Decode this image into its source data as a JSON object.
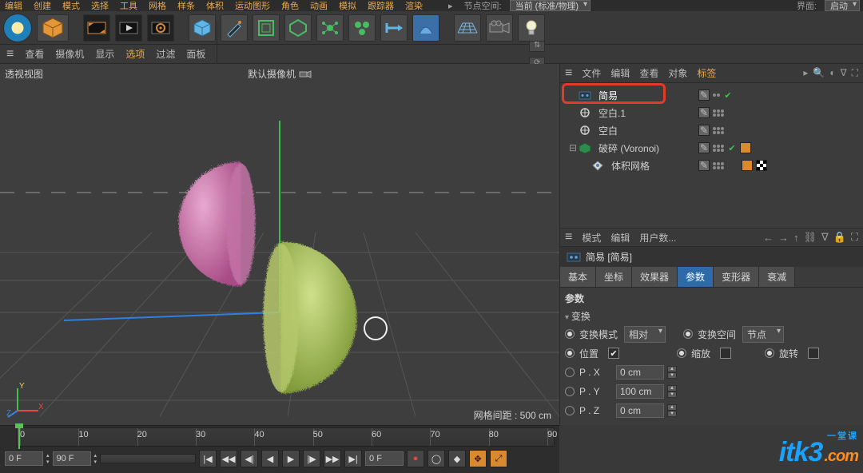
{
  "top_menu": {
    "items": [
      "编辑",
      "创建",
      "模式",
      "选择",
      "工具",
      "网格",
      "样条",
      "体积",
      "运动图形",
      "角色",
      "动画",
      "模拟",
      "跟踪器",
      "渲染"
    ],
    "node_space_label": "节点空间:",
    "node_space_value": "当前 (标准/物理)",
    "layout_label": "界面:",
    "layout_value": "启动"
  },
  "viewport_menu": {
    "items": [
      "查看",
      "摄像机",
      "显示",
      "选项",
      "过滤",
      "面板"
    ],
    "highlight_index": 3
  },
  "viewport": {
    "title": "透视视图",
    "camera": "默认摄像机",
    "status": "网格间距 : 500 cm"
  },
  "object_manager": {
    "menu": [
      "文件",
      "编辑",
      "查看",
      "对象",
      "标签"
    ],
    "highlight_index": 4,
    "rows": [
      {
        "name": "简易",
        "icon": "effector",
        "depth": 0,
        "sel": true,
        "tags": [
          "edit",
          "check-green"
        ]
      },
      {
        "name": "空白.1",
        "icon": "null",
        "depth": 0,
        "tags": [
          "edit",
          "dots"
        ]
      },
      {
        "name": "空白",
        "icon": "null",
        "depth": 0,
        "tags": [
          "edit",
          "dots"
        ]
      },
      {
        "name": "破碎 (Voronoi)",
        "icon": "voronoi",
        "depth": 0,
        "expand": "-",
        "tags": [
          "edit",
          "dots",
          "check-green",
          "orange"
        ]
      },
      {
        "name": "体积网格",
        "icon": "volmesh",
        "depth": 1,
        "tags": [
          "edit",
          "dots",
          "orange",
          "checker"
        ]
      }
    ]
  },
  "attribute_manager": {
    "menu": [
      "模式",
      "编辑",
      "用户数..."
    ],
    "title_icon": "effector",
    "title": "简易 [简易]",
    "tabs": [
      "基本",
      "坐标",
      "效果器",
      "参数",
      "变形器",
      "衰减"
    ],
    "active_tab": 3,
    "section": "参数",
    "subsection": "变换",
    "rows": {
      "transform_mode": {
        "label": "变换模式",
        "value": "相对"
      },
      "transform_space": {
        "label": "变换空间",
        "value": "节点"
      },
      "position": {
        "label": "位置",
        "checked": true
      },
      "scale": {
        "label": "缩放",
        "checked": false
      },
      "rotation": {
        "label": "旋转",
        "checked": false
      },
      "px": {
        "label": "P . X",
        "value": "0 cm"
      },
      "py": {
        "label": "P . Y",
        "value": "100 cm"
      },
      "pz": {
        "label": "P . Z",
        "value": "0 cm"
      }
    }
  },
  "timeline": {
    "ticks": [
      0,
      10,
      20,
      30,
      40,
      50,
      60,
      70,
      80,
      90
    ],
    "cursor": 0,
    "range_start": "0 F",
    "range_end": "90 F",
    "current": "0 F"
  },
  "watermark": {
    "a": "itk3",
    "b": ".com",
    "sub": "一堂课"
  }
}
